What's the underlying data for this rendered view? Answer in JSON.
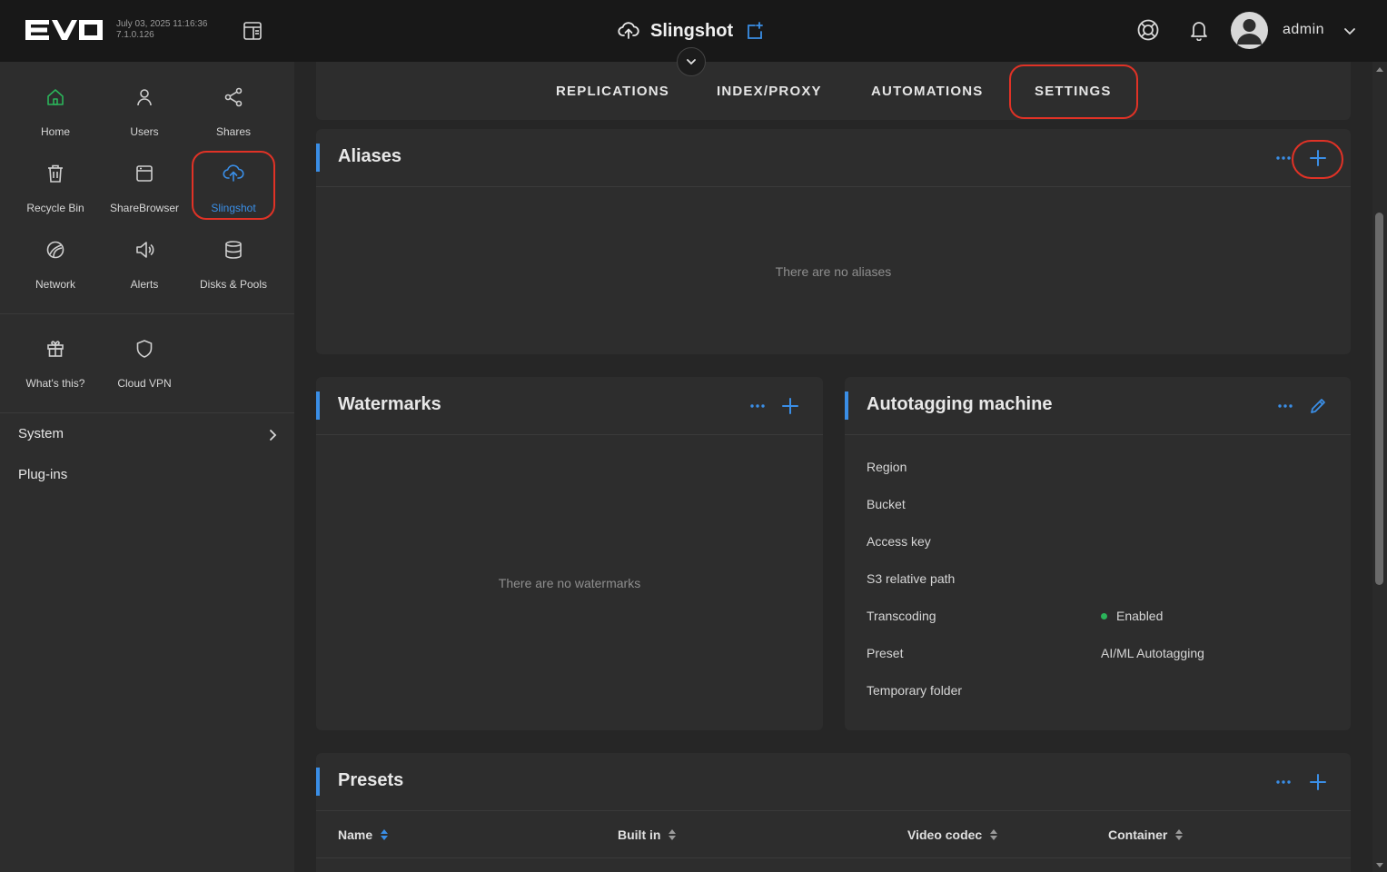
{
  "header": {
    "logo_text": "EVO",
    "build_date": "July 03, 2025 11:16:36",
    "build_version": "7.1.0.126",
    "app_title": "Slingshot",
    "user_name": "admin"
  },
  "sidebar": {
    "tiles": [
      {
        "label": "Home",
        "icon": "home-icon"
      },
      {
        "label": "Users",
        "icon": "user-icon"
      },
      {
        "label": "Shares",
        "icon": "share-icon"
      },
      {
        "label": "Recycle Bin",
        "icon": "trash-icon"
      },
      {
        "label": "ShareBrowser",
        "icon": "browser-window-icon"
      },
      {
        "label": "Slingshot",
        "icon": "cloud-upload-icon",
        "active": true
      },
      {
        "label": "Network",
        "icon": "network-icon"
      },
      {
        "label": "Alerts",
        "icon": "megaphone-icon"
      },
      {
        "label": "Disks & Pools",
        "icon": "database-icon"
      },
      {
        "label": "What's this?",
        "icon": "gift-icon"
      },
      {
        "label": "Cloud VPN",
        "icon": "shield-icon"
      }
    ],
    "links": {
      "system": "System",
      "plugins": "Plug-ins"
    }
  },
  "tabs": [
    "REPLICATIONS",
    "INDEX/PROXY",
    "AUTOMATIONS",
    "SETTINGS"
  ],
  "aliases": {
    "title": "Aliases",
    "empty": "There are no aliases"
  },
  "watermarks": {
    "title": "Watermarks",
    "empty": "There are no watermarks"
  },
  "autotagging": {
    "title": "Autotagging machine",
    "rows": [
      {
        "label": "Region",
        "value": ""
      },
      {
        "label": "Bucket",
        "value": ""
      },
      {
        "label": "Access key",
        "value": ""
      },
      {
        "label": "S3 relative path",
        "value": ""
      },
      {
        "label": "Transcoding",
        "value": "Enabled"
      },
      {
        "label": "Preset",
        "value": "AI/ML Autotagging"
      },
      {
        "label": "Temporary folder",
        "value": ""
      }
    ]
  },
  "presets": {
    "title": "Presets",
    "columns": [
      "Name",
      "Built in",
      "Video codec",
      "Container"
    ]
  },
  "colors": {
    "accent": "#3a8ee6",
    "highlight": "#e03226",
    "status_ok": "#2bb45a"
  }
}
